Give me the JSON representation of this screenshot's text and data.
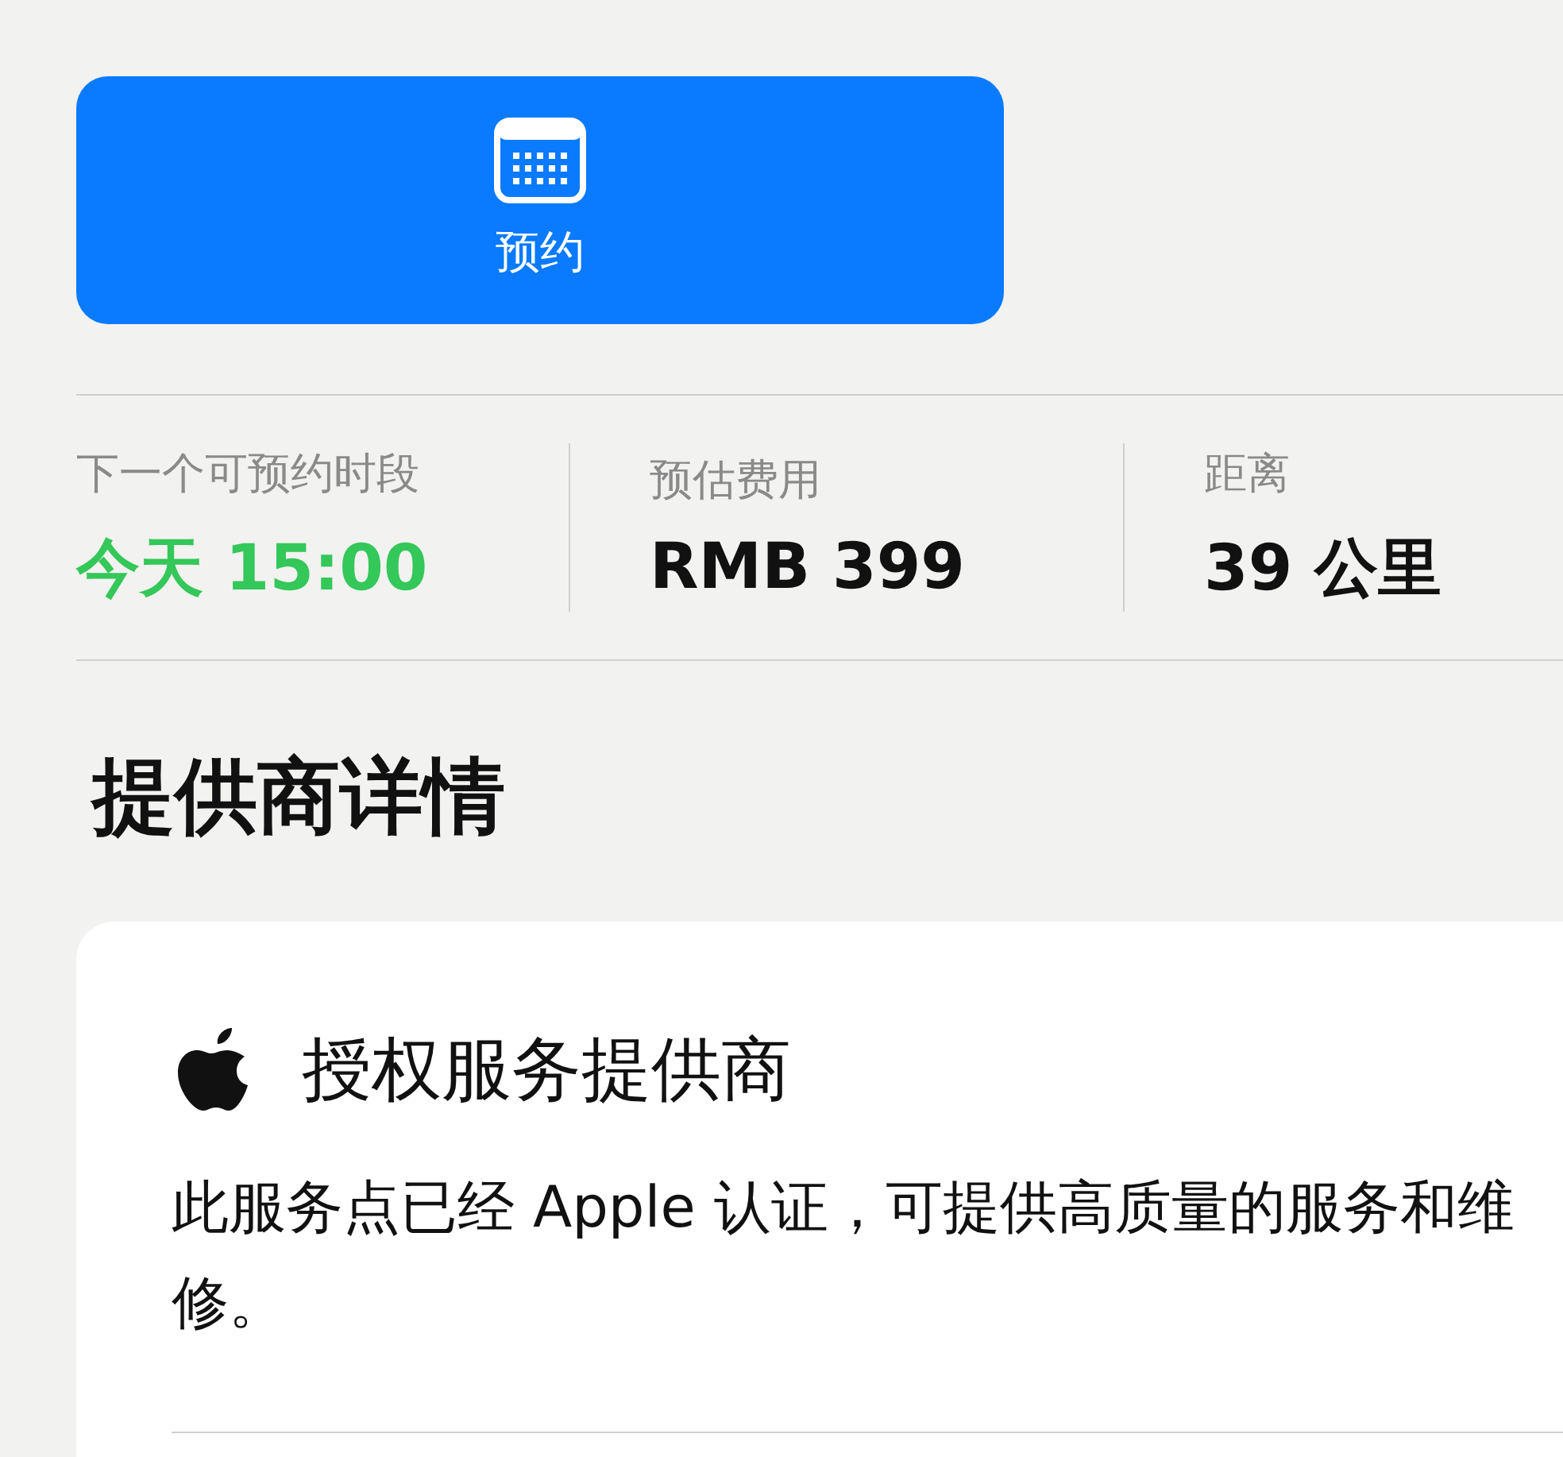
{
  "action_button": {
    "label": "预约"
  },
  "stats": [
    {
      "label": "下一个可预约时段",
      "value": "今天 15:00",
      "kind": "highlight"
    },
    {
      "label": "预估费用",
      "value": "RMB 399",
      "kind": "plain"
    },
    {
      "label": "距离",
      "value": "39 公里",
      "kind": "plain"
    }
  ],
  "section_title": "提供商详情",
  "provider_card": {
    "title": "授权服务提供商",
    "description": "此服务点已经 Apple 认证，可提供高质量的服务和维修。"
  }
}
